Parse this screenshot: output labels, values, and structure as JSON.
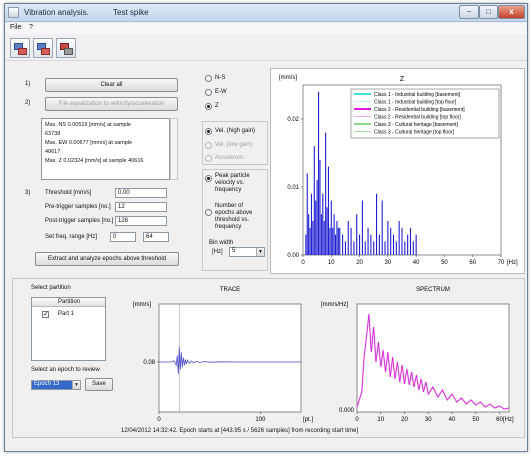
{
  "window": {
    "title": "Vibration analysis.",
    "subtitle": "Test spike",
    "min_label": "−",
    "max_label": "□",
    "close_label": "x"
  },
  "menu": [
    {
      "label": "File"
    },
    {
      "label": "?"
    }
  ],
  "toolbar": {
    "buttons": [
      {
        "icon": "open-data-icon"
      },
      {
        "icon": "export-data-icon"
      },
      {
        "icon": "report-icon"
      }
    ]
  },
  "steps": {
    "step1_num": "1)",
    "clear_all": "Clear all",
    "step2_num": "2)",
    "file_equalization": "File equalization to velocity/acceleration",
    "stats": [
      "Max. NS 0.00519 [mm/s]  at sample",
      "63738",
      "Max. EW 0.00677 [mm/s]  at sample",
      "40617",
      "Max. Z 0.02324 [mm/s]  at sample  40616"
    ],
    "step3_num": "3)",
    "threshold_label": "Threshold [mm/s]",
    "threshold_value": "0.00",
    "pre_trigger_label": "Pre-trigger samples [no.]",
    "pre_trigger_value": "12",
    "post_trigger_label": "Post-trigger samples [no.]",
    "post_trigger_value": "128",
    "freq_range_label": "Set freq. range [Hz]",
    "freq_min": "0",
    "freq_max": "64",
    "extract_button": "Extract and analyze epochs above threshold"
  },
  "options": {
    "components": [
      {
        "label": "N-S",
        "selected": false
      },
      {
        "label": "E-W",
        "selected": false
      },
      {
        "label": "Z",
        "selected": true
      }
    ],
    "sensors": [
      {
        "label": "Vel. (high gain)",
        "selected": true,
        "enabled": true
      },
      {
        "label": "Vel. (low gain)",
        "selected": false,
        "enabled": false
      },
      {
        "label": "Accelerom.",
        "selected": false,
        "enabled": false
      }
    ],
    "plot_mode": [
      {
        "lines": [
          "Peak particle",
          "velocity vs.",
          "frequency"
        ],
        "selected": true
      },
      {
        "lines": [
          "Number of",
          "epochs above",
          "threshold vs.",
          "frequency"
        ],
        "selected": false
      }
    ],
    "bin_width_label1": "Bin width",
    "bin_width_label2": "[Hz]",
    "bin_width_value": "5"
  },
  "partition": {
    "title": "Select partition",
    "header": "Partition",
    "items": [
      {
        "label": "Part 1",
        "checked": true
      }
    ],
    "epoch_label": "Select an epoch to review",
    "epoch_value": "Epoch 13",
    "save_label": "Save"
  },
  "status_text": "12/04/2012 14:32:42. Epoch starts at [443.95 s / 5626 samples] from recording start time]",
  "colors": {
    "window_bg": "#f0f0f0",
    "hist_bar": "#1f1fd2",
    "trace_line": "#4f4fd0",
    "spectrum_line": "#d419d4",
    "spectrum_line2": "#ef9bef",
    "class1_base": "#3fe0e0",
    "class1_top": "#bff5f5",
    "class2_base": "#e019e0",
    "class2_top": "#f0a8f0",
    "class3_base": "#18b018",
    "class3_top": "#a8e0a8"
  },
  "chart_data": [
    {
      "type": "bar",
      "title": "Z",
      "ylabel": "[mm/s]",
      "xlabel": "[Hz]",
      "xlim": [
        0,
        70
      ],
      "ylim": [
        0,
        0.025
      ],
      "xticks": [
        0,
        10,
        20,
        30,
        40,
        50,
        60,
        70
      ],
      "yticks": [
        0.0,
        0.01,
        0.02
      ],
      "ytick_labels": [
        "0.00",
        "0.01",
        "0.02"
      ],
      "legend_position": "top-right",
      "legend": [
        {
          "name": "Class 1 - Industrial building [basement]",
          "color": "#3fe0e0",
          "width": 2
        },
        {
          "name": "Class 1 - Industrial building [top floor]",
          "color": "#bff5f5",
          "width": 1
        },
        {
          "name": "Class 2 - Residential building [basement]",
          "color": "#e019e0",
          "width": 2
        },
        {
          "name": "Class 2 - Residential building [top floor]",
          "color": "#f0a8f0",
          "width": 1
        },
        {
          "name": "Class 3 - Cultural heritage [basement]",
          "color": "#18b018",
          "width": 1
        },
        {
          "name": "Class 3 - Cultural heritage [top floor]",
          "color": "#a8e0a8",
          "width": 1
        }
      ],
      "bars": [
        [
          1,
          0.003
        ],
        [
          1.5,
          0.012
        ],
        [
          2,
          0.006
        ],
        [
          2.5,
          0.004
        ],
        [
          3,
          0.009
        ],
        [
          3.5,
          0.005
        ],
        [
          4,
          0.016
        ],
        [
          4.5,
          0.008
        ],
        [
          5,
          0.011
        ],
        [
          5.5,
          0.024
        ],
        [
          6,
          0.014
        ],
        [
          6.5,
          0.006
        ],
        [
          7,
          0.009
        ],
        [
          7.5,
          0.005
        ],
        [
          8,
          0.018
        ],
        [
          8.5,
          0.007
        ],
        [
          9,
          0.013
        ],
        [
          9.5,
          0.004
        ],
        [
          10,
          0.008
        ],
        [
          10.5,
          0.004
        ],
        [
          11,
          0.006
        ],
        [
          11.5,
          0.003
        ],
        [
          12,
          0.005
        ],
        [
          12.5,
          0.004
        ],
        [
          13,
          0.004
        ],
        [
          14,
          0.003
        ],
        [
          15,
          0.002
        ],
        [
          16,
          0.005
        ],
        [
          17,
          0.004
        ],
        [
          18,
          0.002
        ],
        [
          19,
          0.006
        ],
        [
          20,
          0.003
        ],
        [
          21,
          0.008
        ],
        [
          22,
          0.002
        ],
        [
          23,
          0.004
        ],
        [
          24,
          0.003
        ],
        [
          25,
          0.002
        ],
        [
          26,
          0.009
        ],
        [
          27,
          0.003
        ],
        [
          28,
          0.008
        ],
        [
          29,
          0.002
        ],
        [
          30,
          0.005
        ],
        [
          31,
          0.004
        ],
        [
          32,
          0.003
        ],
        [
          33,
          0.002
        ],
        [
          34,
          0.005
        ],
        [
          35,
          0.004
        ],
        [
          36,
          0.002
        ],
        [
          37,
          0.003
        ],
        [
          38,
          0.004
        ],
        [
          39,
          0.002
        ],
        [
          40,
          0.003
        ]
      ]
    },
    {
      "type": "line",
      "title": "TRACE",
      "ylabel": "[mm/s]",
      "xlabel": "[pt.]",
      "xlim": [
        0,
        140
      ],
      "xticks": [
        0,
        100
      ],
      "ytick_labels": [
        "0.08"
      ],
      "baseline_value": 0.08,
      "spike_x": 20,
      "series": [
        {
          "x": [
            0,
            12,
            15,
            17,
            18,
            19,
            20,
            21,
            22,
            23,
            24,
            25,
            26,
            27,
            28,
            30,
            32,
            34,
            37,
            40,
            45,
            50,
            60,
            80,
            100,
            140
          ],
          "y": [
            0,
            0,
            0.05,
            -0.15,
            0.3,
            -0.55,
            0.7,
            -0.35,
            0.45,
            -0.25,
            0.2,
            -0.15,
            0.12,
            -0.1,
            0.08,
            -0.06,
            0.05,
            -0.04,
            0.03,
            -0.02,
            0.02,
            -0.01,
            0.01,
            0,
            0,
            0
          ]
        }
      ]
    },
    {
      "type": "line",
      "title": "SPECTRUM",
      "ylabel": "[mm/s/Hz]",
      "xlabel": "[Hz]",
      "xlim": [
        0,
        64
      ],
      "xticks": [
        0,
        10,
        20,
        30,
        40,
        50,
        60
      ],
      "ytick_labels": [
        "0.000"
      ],
      "series": [
        {
          "x": [
            0,
            2,
            3,
            4,
            5,
            6,
            7,
            8,
            9,
            10,
            11,
            12,
            13,
            14,
            15,
            16,
            17,
            18,
            19,
            20,
            21,
            22,
            23,
            24,
            25,
            26,
            27,
            28,
            29,
            30,
            32,
            34,
            36,
            38,
            40,
            42,
            44,
            46,
            48,
            50,
            52,
            54,
            56,
            58,
            60,
            62,
            64
          ],
          "y": [
            0.05,
            0.2,
            0.55,
            0.75,
            0.98,
            0.6,
            0.85,
            0.5,
            0.7,
            0.45,
            0.62,
            0.4,
            0.6,
            0.35,
            0.55,
            0.33,
            0.5,
            0.3,
            0.47,
            0.28,
            0.43,
            0.27,
            0.4,
            0.25,
            0.37,
            0.22,
            0.33,
            0.2,
            0.3,
            0.18,
            0.25,
            0.15,
            0.22,
            0.12,
            0.18,
            0.1,
            0.14,
            0.08,
            0.12,
            0.07,
            0.1,
            0.05,
            0.08,
            0.04,
            0.06,
            0.03,
            0.04
          ]
        }
      ]
    }
  ]
}
